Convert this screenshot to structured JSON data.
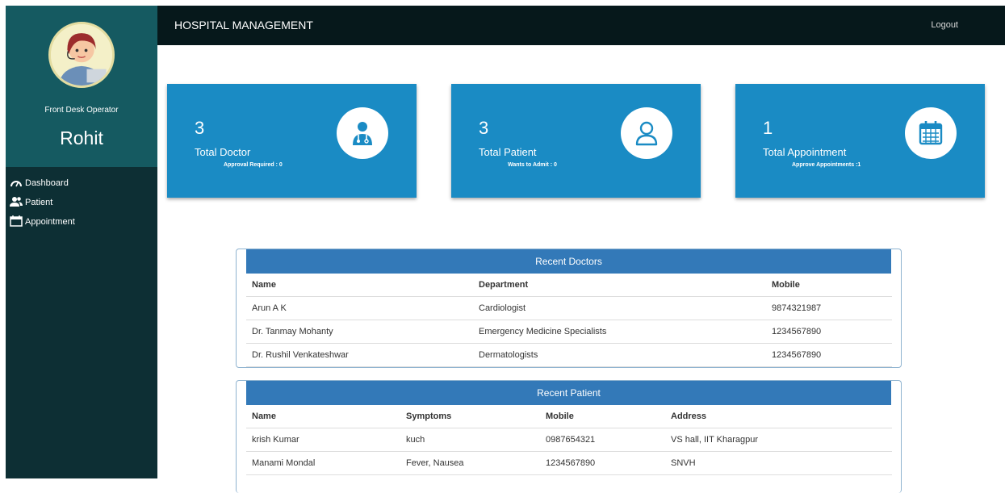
{
  "app": {
    "title": "HOSPITAL MANAGEMENT",
    "logout_label": "Logout"
  },
  "profile": {
    "role": "Front Desk Operator",
    "name": "Rohit"
  },
  "nav": [
    {
      "label": "Dashboard",
      "icon": "dashboard-gauge-icon"
    },
    {
      "label": "Patient",
      "icon": "users-icon"
    },
    {
      "label": "Appointment",
      "icon": "calendar-icon"
    }
  ],
  "cards": [
    {
      "count": "3",
      "label": "Total Doctor",
      "sub": "Approval Required : 0",
      "icon": "doctor-icon"
    },
    {
      "count": "3",
      "label": "Total Patient",
      "sub": "Wants to Admit : 0",
      "icon": "user-outline-icon"
    },
    {
      "count": "1",
      "label": "Total Appointment",
      "sub": "Approve Appointments :1",
      "icon": "calendar-icon"
    }
  ],
  "recent_doctors": {
    "title": "Recent Doctors",
    "columns": [
      "Name",
      "Department",
      "Mobile"
    ],
    "rows": [
      [
        "Arun A K",
        "Cardiologist",
        "9874321987"
      ],
      [
        "Dr. Tanmay Mohanty",
        "Emergency Medicine Specialists",
        "1234567890"
      ],
      [
        "Dr. Rushil Venkateshwar",
        "Dermatologists",
        "1234567890"
      ]
    ]
  },
  "recent_patients": {
    "title": "Recent Patient",
    "columns": [
      "Name",
      "Symptoms",
      "Mobile",
      "Address"
    ],
    "rows": [
      [
        "krish Kumar",
        "kuch",
        "0987654321",
        "VS hall, IIT Kharagpur"
      ],
      [
        "Manami Mondal",
        "Fever, Nausea",
        "1234567890",
        "SNVH"
      ]
    ]
  },
  "colors": {
    "sidebar": "#0d2f34",
    "profile_bg": "#155a61",
    "topbar": "#06181b",
    "card": "#1a8bc4",
    "panel_head": "#3379b8"
  }
}
